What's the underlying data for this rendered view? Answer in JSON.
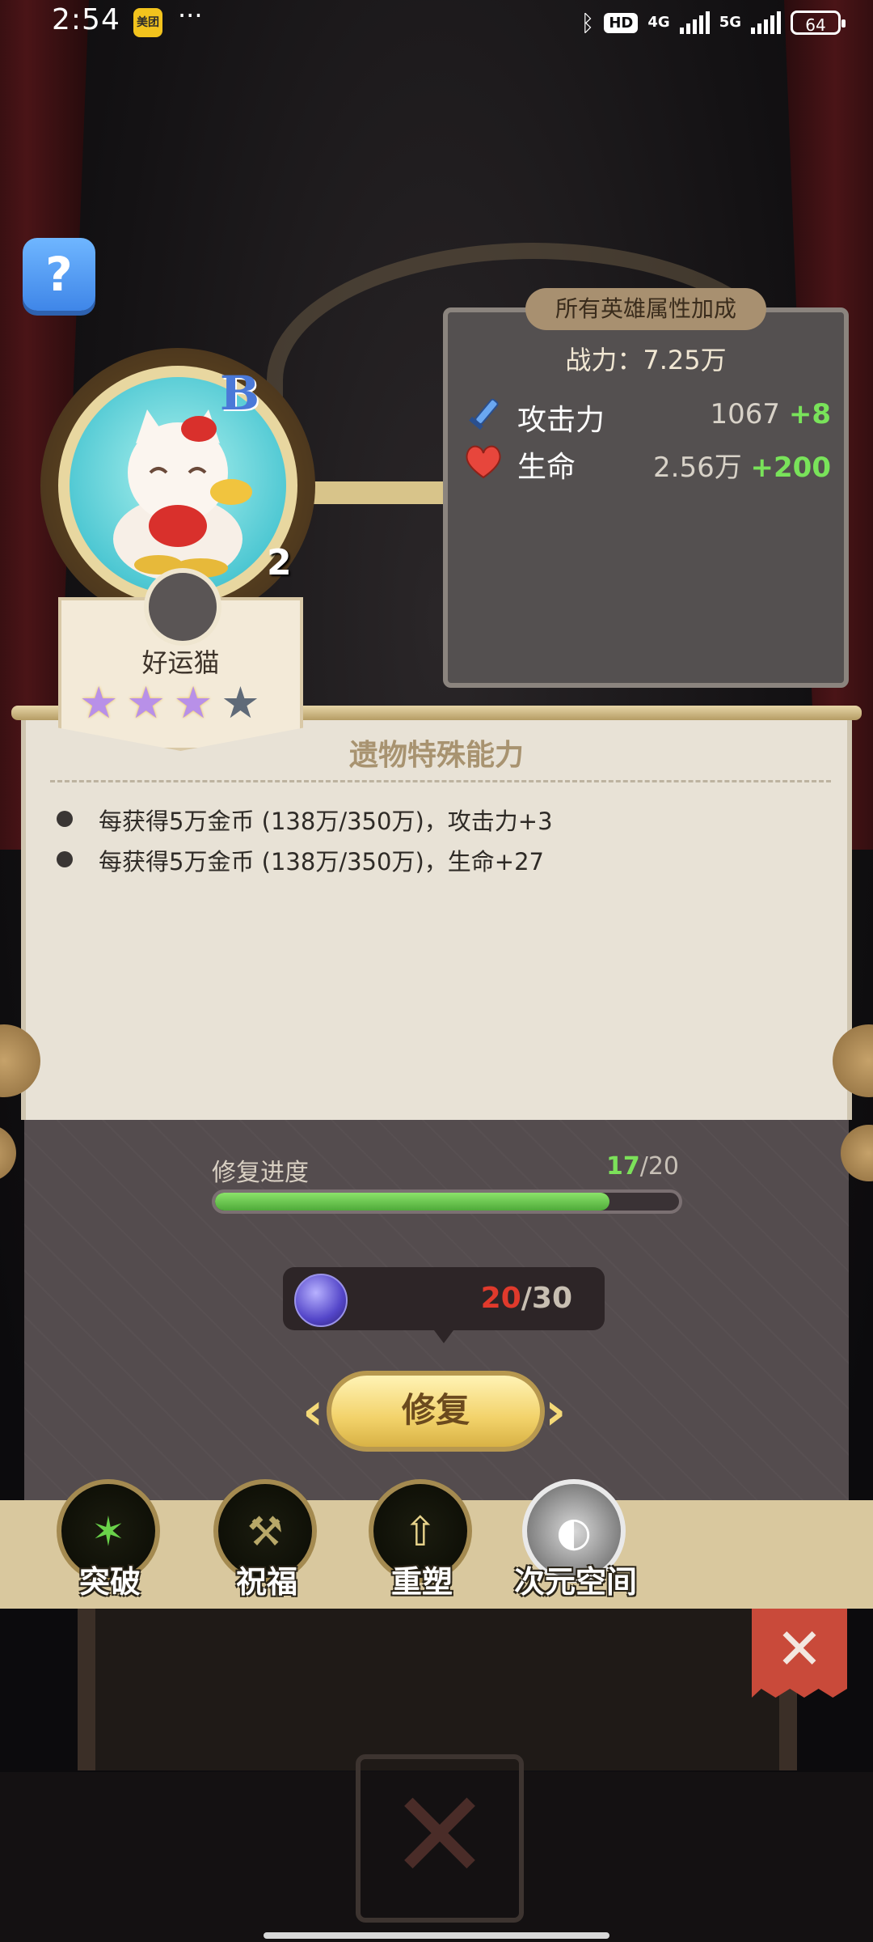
{
  "status_bar": {
    "time": "2:54",
    "app_badge": "美团",
    "more": "···",
    "network_4g": "4G",
    "network_5g": "5G",
    "hd": "HD",
    "battery": "64"
  },
  "help_button": {
    "label": "?"
  },
  "hero": {
    "grade": "B",
    "level": "2",
    "name": "好运猫",
    "stars_filled": 3,
    "stars_total": 4
  },
  "bonus": {
    "tag": "所有英雄属性加成",
    "power_label": "战力：7.25万",
    "stats": [
      {
        "name": "攻击力",
        "value": "1067",
        "plus": "+8",
        "icon": "sword-icon"
      },
      {
        "name": "生命",
        "value": "2.56万",
        "plus": "+200",
        "icon": "heart-icon"
      }
    ]
  },
  "ability": {
    "title": "遗物特殊能力",
    "items": [
      "每获得5万金币 (138万/350万)，攻击力+3",
      "每获得5万金币 (138万/350万)，生命+27"
    ]
  },
  "repair": {
    "label": "修复进度",
    "current": "17",
    "total": "/20",
    "progress_fraction": 0.85,
    "cost_have": "20",
    "cost_need": "/30",
    "button": "修复",
    "prev": "‹",
    "next": "›"
  },
  "tabs": [
    {
      "label": "突破",
      "icon": "claw-icon"
    },
    {
      "label": "祝福",
      "icon": "hammer-icon"
    },
    {
      "label": "重塑",
      "icon": "anvil-icon"
    },
    {
      "label": "次元空间",
      "icon": "planet-icon"
    }
  ],
  "close_label": "✕",
  "colors": {
    "accent_green": "#79e35a",
    "danger_red": "#e03a2c",
    "button_gold": "#f2d26a"
  }
}
